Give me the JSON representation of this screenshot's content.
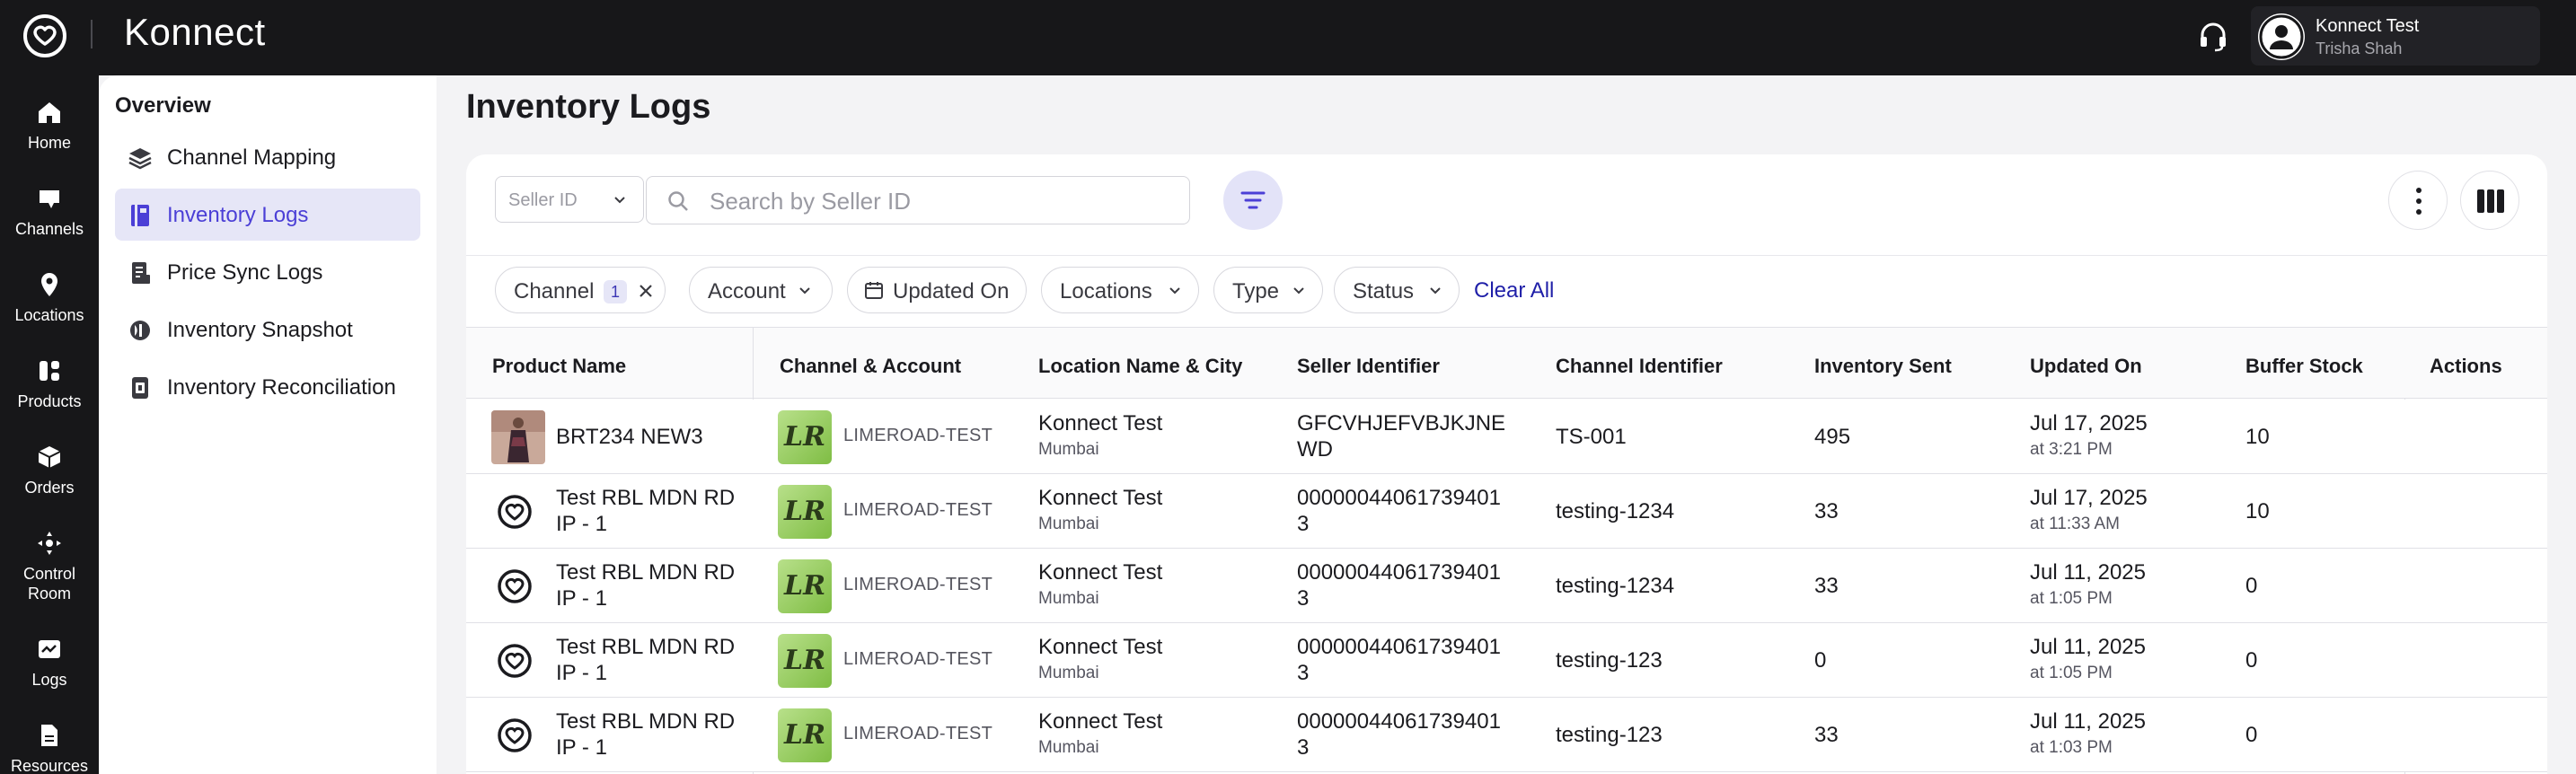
{
  "app": {
    "brand": "Konnect"
  },
  "user": {
    "name": "Konnect Test",
    "sub": "Trisha Shah"
  },
  "rail": [
    {
      "label": "Home",
      "icon": "home-icon"
    },
    {
      "label": "Channels",
      "icon": "channels-icon"
    },
    {
      "label": "Locations",
      "icon": "location-pin-icon"
    },
    {
      "label": "Products",
      "icon": "products-icon"
    },
    {
      "label": "Orders",
      "icon": "box-icon"
    },
    {
      "label": "Control Room",
      "icon": "control-room-icon"
    },
    {
      "label": "Logs",
      "icon": "logs-icon"
    },
    {
      "label": "Resources",
      "icon": "document-icon"
    }
  ],
  "subnav": {
    "heading": "Overview",
    "items": [
      {
        "label": "Channel Mapping",
        "icon": "layers-icon"
      },
      {
        "label": "Inventory Logs",
        "icon": "book-icon",
        "active": true
      },
      {
        "label": "Price Sync Logs",
        "icon": "receipt-icon"
      },
      {
        "label": "Inventory Snapshot",
        "icon": "snapshot-icon"
      },
      {
        "label": "Inventory Reconciliation",
        "icon": "reconcile-icon"
      }
    ]
  },
  "page": {
    "title": "Inventory Logs"
  },
  "toolbar": {
    "seller_select": "Seller ID",
    "search_placeholder": "Search by Seller ID"
  },
  "filters": {
    "channel": {
      "label": "Channel",
      "count": "1"
    },
    "account": "Account",
    "updated_on": "Updated On",
    "locations": "Locations",
    "type": "Type",
    "status": "Status",
    "clear_all": "Clear All"
  },
  "table": {
    "columns": [
      "Product Name",
      "Channel & Account",
      "Location Name & City",
      "Seller Identifier",
      "Channel Identifier",
      "Inventory Sent",
      "Updated On",
      "Buffer Stock",
      "Actions"
    ],
    "rows": [
      {
        "product": [
          "BRT234 NEW3",
          ""
        ],
        "image": "photo",
        "channel_logo": "LR",
        "account": "LIMEROAD-TEST",
        "location": "Konnect Test",
        "city": "Mumbai",
        "seller_id": [
          "GFCVHJEFVBJKJNE",
          "WD"
        ],
        "channel_id": "TS-001",
        "inventory_sent": "495",
        "updated_date": "Jul 17, 2025",
        "updated_time": "at 3:21 PM",
        "buffer": "10"
      },
      {
        "product": [
          "Test RBL MDN RD",
          "IP - 1"
        ],
        "image": "logo",
        "channel_logo": "LR",
        "account": "LIMEROAD-TEST",
        "location": "Konnect Test",
        "city": "Mumbai",
        "seller_id": [
          "00000044061739401",
          "3"
        ],
        "channel_id": "testing-1234",
        "inventory_sent": "33",
        "updated_date": "Jul 17, 2025",
        "updated_time": "at 11:33 AM",
        "buffer": "10"
      },
      {
        "product": [
          "Test RBL MDN RD",
          "IP - 1"
        ],
        "image": "logo",
        "channel_logo": "LR",
        "account": "LIMEROAD-TEST",
        "location": "Konnect Test",
        "city": "Mumbai",
        "seller_id": [
          "00000044061739401",
          "3"
        ],
        "channel_id": "testing-1234",
        "inventory_sent": "33",
        "updated_date": "Jul 11, 2025",
        "updated_time": "at 1:05 PM",
        "buffer": "0"
      },
      {
        "product": [
          "Test RBL MDN RD",
          "IP - 1"
        ],
        "image": "logo",
        "channel_logo": "LR",
        "account": "LIMEROAD-TEST",
        "location": "Konnect Test",
        "city": "Mumbai",
        "seller_id": [
          "00000044061739401",
          "3"
        ],
        "channel_id": "testing-123",
        "inventory_sent": "0",
        "updated_date": "Jul 11, 2025",
        "updated_time": "at 1:05 PM",
        "buffer": "0"
      },
      {
        "product": [
          "Test RBL MDN RD",
          "IP - 1"
        ],
        "image": "logo",
        "channel_logo": "LR",
        "account": "LIMEROAD-TEST",
        "location": "Konnect Test",
        "city": "Mumbai",
        "seller_id": [
          "00000044061739401",
          "3"
        ],
        "channel_id": "testing-123",
        "inventory_sent": "33",
        "updated_date": "Jul 11, 2025",
        "updated_time": "at 1:03 PM",
        "buffer": "0"
      }
    ]
  },
  "colors": {
    "topbar": "#171719",
    "accent": "#4b3fd6",
    "active_bg": "#e6e6f7",
    "link": "#1f1fa8"
  }
}
